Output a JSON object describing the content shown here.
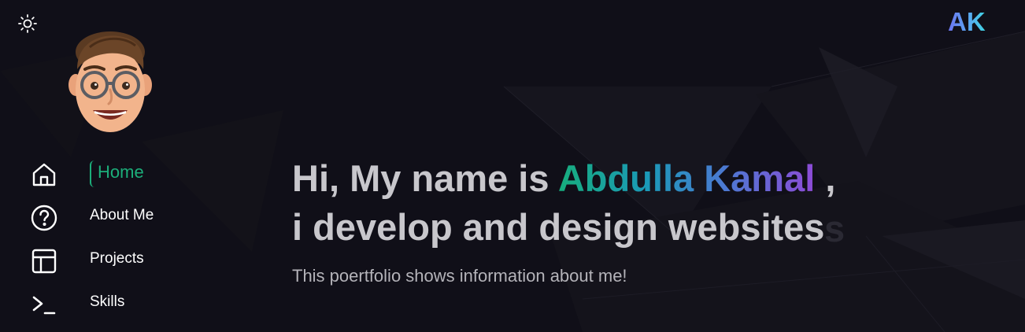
{
  "header": {
    "logo": "AK",
    "theme_toggle_icon": "sun-icon"
  },
  "sidebar": {
    "avatar_icon": "memoji-avatar",
    "items": [
      {
        "label": "Home",
        "icon": "home-icon",
        "active": true
      },
      {
        "label": "About Me",
        "icon": "question-circle-icon",
        "active": false
      },
      {
        "label": "Projects",
        "icon": "layout-icon",
        "active": false
      },
      {
        "label": "Skills",
        "icon": "terminal-icon",
        "active": false
      }
    ]
  },
  "hero": {
    "greeting": "Hi, My name is ",
    "name": "Abdulla Kamal",
    "comma": " ,",
    "line2": "i develop and design websites",
    "line2_ghost": "s",
    "subtitle": "This poertfolio shows information about me!"
  },
  "colors": {
    "background": "#100f18",
    "accent_green": "#1cae7a",
    "heading_text": "#c8c7cc",
    "subtitle_text": "#b4b3b9"
  }
}
